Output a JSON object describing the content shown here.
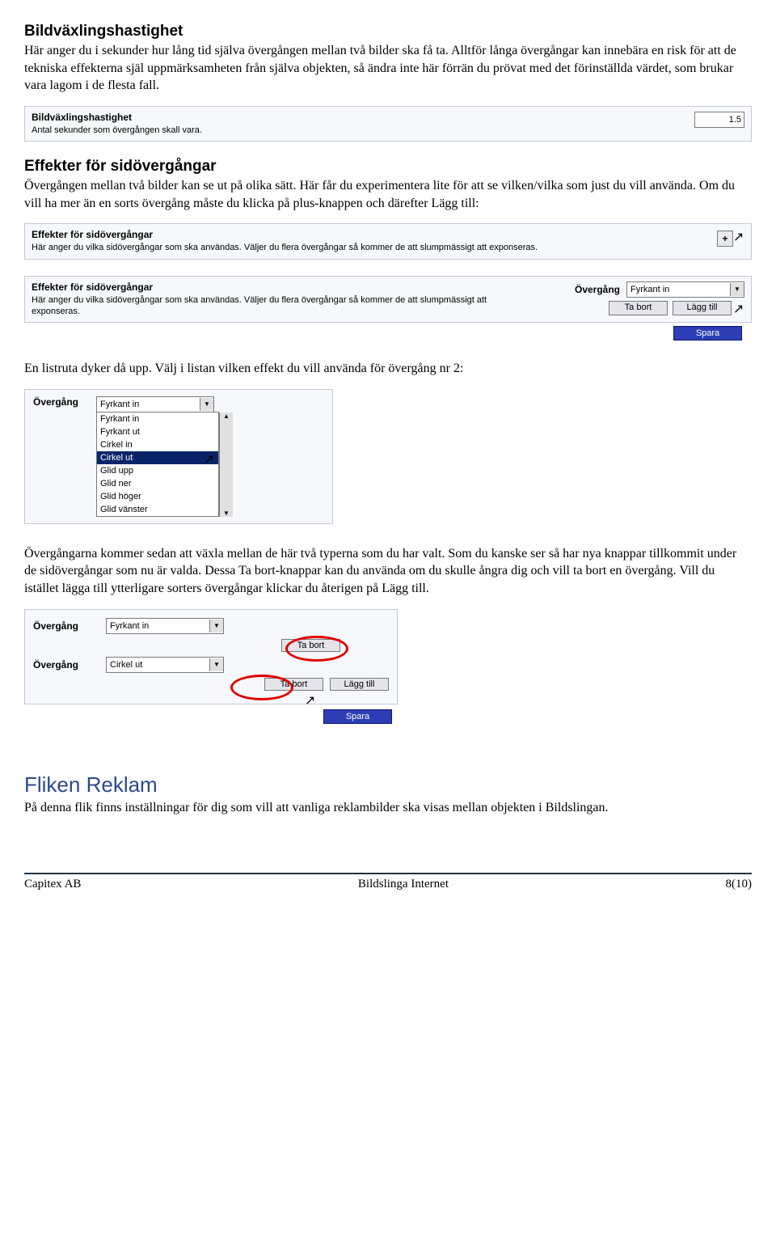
{
  "section1": {
    "title": "Bildväxlingshastighet",
    "body": "Här anger du i sekunder hur lång tid själva övergången mellan två bilder ska få ta. Alltför långa övergångar kan innebära en risk för att de tekniska effekterna själ uppmärksamheten från själva objekten, så ändra inte här förrän du prövat med det förinställda värdet, som brukar vara lagom i de flesta fall."
  },
  "panel1": {
    "title": "Bildväxlingshastighet",
    "desc": "Antal sekunder som övergången skall vara.",
    "value": "1.5"
  },
  "section2": {
    "title": "Effekter för sidövergångar",
    "body": "Övergången mellan två bilder kan se ut på olika sätt. Här får du experimentera lite för att se vilken/vilka som just du vill använda. Om du vill ha mer än en sorts övergång måste du klicka på plus-knappen och därefter Lägg till:"
  },
  "fxpanel": {
    "title": "Effekter för sidövergångar",
    "desc": "Här anger du vilka sidövergångar som ska användas. Väljer du flera övergångar så kommer de att slumpmässigt att exponseras.",
    "dropdown_label": "Övergång",
    "dropdown_value": "Fyrkant in",
    "btn_remove": "Ta bort",
    "btn_add": "Lägg till",
    "btn_save": "Spara"
  },
  "midtext": "En listruta dyker då upp. Välj i listan vilken effekt du vill använda för övergång nr 2:",
  "listpanel": {
    "label": "Övergång",
    "selected": "Fyrkant in",
    "options": [
      "Fyrkant in",
      "Fyrkant ut",
      "Cirkel in",
      "Cirkel ut",
      "Glid upp",
      "Glid ner",
      "Glid höger",
      "Glid vänster"
    ],
    "selected_index": 3
  },
  "section3": {
    "body": "Övergångarna kommer sedan att växla mellan de här två typerna som du har valt. Som du kanske ser så har nya knappar tillkommit under de sidövergångar som nu är valda. Dessa Ta bort-knappar kan du använda om du skulle ångra dig och vill ta bort en övergång. Vill du istället lägga till ytterligare sorters övergångar klickar du återigen på Lägg till."
  },
  "panel4": {
    "label": "Övergång",
    "row1_value": "Fyrkant in",
    "row2_value": "Cirkel ut",
    "btn_remove": "Ta bort",
    "btn_add": "Lägg till",
    "btn_save": "Spara"
  },
  "section4": {
    "title": "Fliken Reklam",
    "body": "På denna flik finns inställningar för dig som vill att vanliga reklambilder ska visas mellan objekten i Bildslingan."
  },
  "footer": {
    "left": "Capitex AB",
    "center": "Bildslinga Internet",
    "right": "8(10)"
  }
}
